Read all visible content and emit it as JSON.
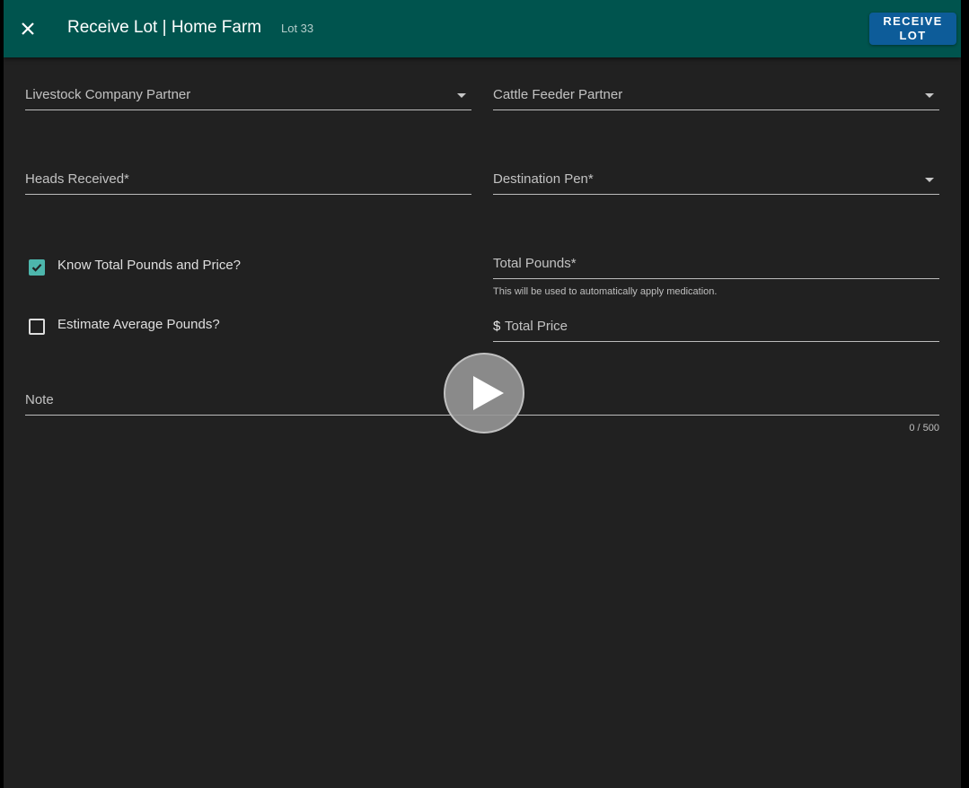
{
  "header": {
    "title": "Receive Lot | Home Farm",
    "subtitle": "Lot 33",
    "action_line1": "RECEIVE",
    "action_line2": "LOT"
  },
  "form": {
    "livestock_partner_label": "Livestock Company Partner",
    "cattle_feeder_label": "Cattle Feeder Partner",
    "heads_received_label": "Heads Received*",
    "destination_pen_label": "Destination Pen*",
    "know_total_label": "Know Total Pounds and Price?",
    "know_total_checked": true,
    "estimate_avg_label": "Estimate Average Pounds?",
    "estimate_avg_checked": false,
    "total_pounds_label": "Total Pounds*",
    "total_pounds_hint": "This will be used to automatically apply medication.",
    "total_price_prefix": "$",
    "total_price_label": "Total Price",
    "note_label": "Note",
    "note_counter": "0 / 500"
  },
  "colors": {
    "toolbar": "#00544e",
    "button": "#0d5c99",
    "checkbox": "#4db6ac",
    "background": "#212121"
  },
  "icons": {
    "close": "close-icon",
    "dropdown": "chevron-down-icon",
    "play": "play-icon",
    "check": "check-icon"
  }
}
